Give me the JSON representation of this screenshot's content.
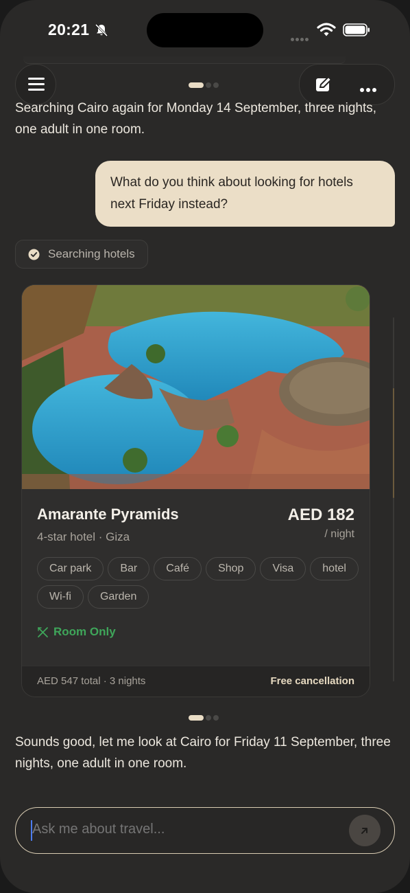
{
  "status_bar": {
    "time": "20:21"
  },
  "top_bar": {
    "pager_active": 0,
    "pager_count": 3
  },
  "messages": {
    "assistant_1": "Searching Cairo again for Monday 14 September, three nights, one adult in one room.",
    "user_1": "What do you think about looking for hotels next Friday instead?",
    "tool_chip": "Searching hotels",
    "assistant_2": "Sounds good, let me look at Cairo for Friday 11 September, three nights, one adult in one room."
  },
  "hotel_card": {
    "name": "Amarante Pyramids",
    "subtitle": "4-star hotel · Giza",
    "price": "AED 182",
    "per_night": "/ night",
    "tags": [
      "Car park",
      "Bar",
      "Café",
      "Shop",
      "Visa",
      "hotel",
      "Wi-fi",
      "Garden"
    ],
    "board": "Room Only",
    "total": "AED 547 total · 3 nights",
    "cancellation": "Free cancellation",
    "board_color": "#3fa65a"
  },
  "carousel": {
    "active": 0,
    "count": 3
  },
  "input": {
    "placeholder": "Ask me about travel..."
  },
  "colors": {
    "accent": "#ebdec7",
    "background": "#2a2928"
  }
}
